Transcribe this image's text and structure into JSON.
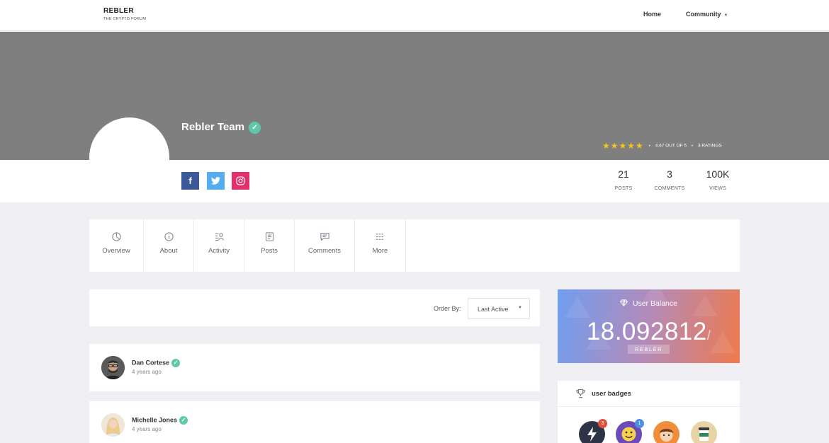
{
  "nav": {
    "brand": "REBLER",
    "tagline": "THE CRYPTO FORUM",
    "links": [
      {
        "label": "Home"
      },
      {
        "label": "Community"
      }
    ]
  },
  "profile": {
    "name": "Rebler Team",
    "rating_stars": 4.67,
    "rating_text": "4.67 OUT OF 5",
    "ratings_count": "3 RATINGS",
    "social": [
      "facebook",
      "twitter",
      "instagram"
    ],
    "stats": [
      {
        "value": "21",
        "label": "POSTS"
      },
      {
        "value": "3",
        "label": "COMMENTS"
      },
      {
        "value": "100K",
        "label": "VIEWS"
      }
    ]
  },
  "tabs": [
    {
      "label": "Overview",
      "icon": "overview-icon"
    },
    {
      "label": "About",
      "icon": "info-icon"
    },
    {
      "label": "Activity",
      "icon": "activity-icon"
    },
    {
      "label": "Posts",
      "icon": "document-icon"
    },
    {
      "label": "Comments",
      "icon": "comment-icon"
    },
    {
      "label": "More",
      "icon": "menu-lines-icon"
    }
  ],
  "order": {
    "label": "Order By:",
    "selected": "Last Active"
  },
  "posts": [
    {
      "author": "Dan Cortese",
      "time": "4 years ago"
    },
    {
      "author": "Michelle Jones",
      "time": "4 years ago"
    }
  ],
  "balance": {
    "title": "User Balance",
    "amount": "18.092812",
    "unit": "REBLER"
  },
  "badges": {
    "title": "user badges",
    "items": [
      {
        "icon": "lightning-badge-icon",
        "count": "3",
        "color": "#2d3446"
      },
      {
        "icon": "smiley-badge-icon",
        "count": "1",
        "color": "#6b4bb8"
      },
      {
        "icon": "face-badge-icon",
        "color": "#f08c3a"
      },
      {
        "icon": "cup-badge-icon",
        "color": "#e7d3a5"
      }
    ]
  }
}
